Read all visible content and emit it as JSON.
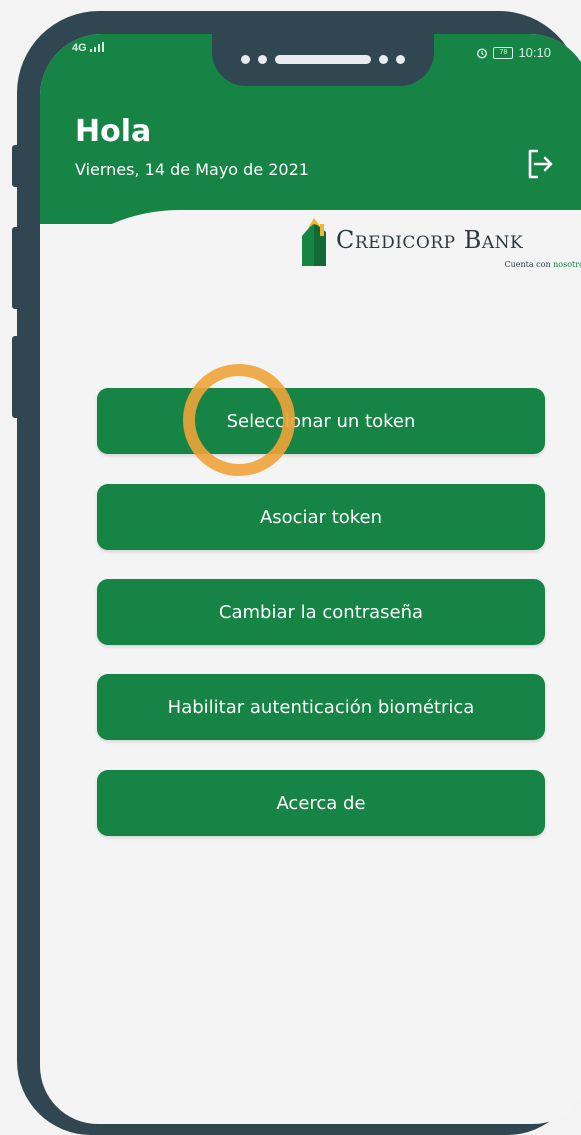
{
  "status_bar": {
    "signal_text": "4G",
    "alarm_icon": "alarm-icon",
    "battery_text": "78",
    "time": "10:10"
  },
  "header": {
    "greeting": "Hola",
    "date": "Viernes, 14 de Mayo de 2021",
    "logout_icon": "logout-icon"
  },
  "logo": {
    "name": "Credicorp Bank",
    "tagline_prefix": "Cuenta con",
    "tagline_accent": "nosotros"
  },
  "menu": {
    "items": [
      {
        "label": "Seleccionar un token"
      },
      {
        "label": "Asociar token"
      },
      {
        "label": "Cambiar la contraseña"
      },
      {
        "label": "Habilitar autenticación biométrica"
      },
      {
        "label": "Acerca de"
      }
    ]
  },
  "colors": {
    "brand_green": "#158445",
    "frame": "#304752",
    "tap_highlight": "#f0a43a",
    "background": "#f4f4f4"
  }
}
